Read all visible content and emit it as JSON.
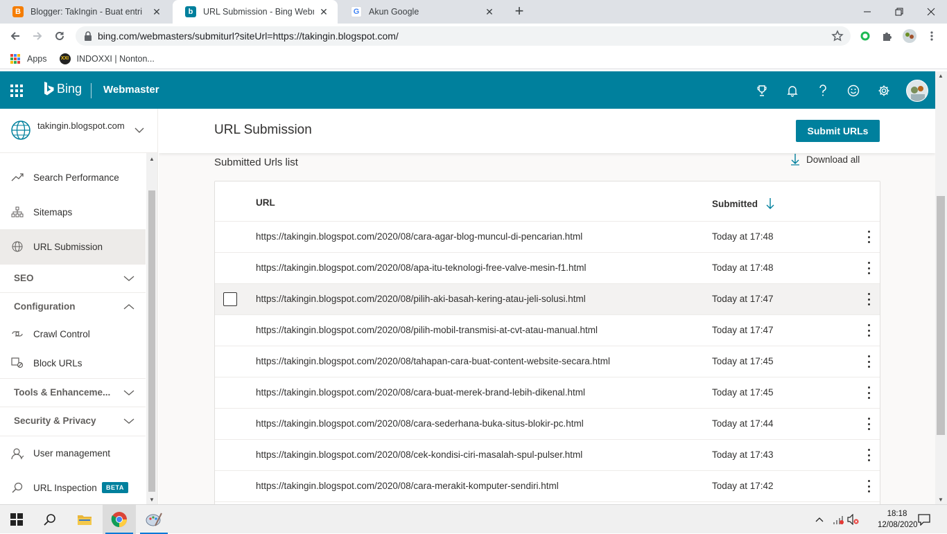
{
  "browser": {
    "tabs": [
      {
        "title": "Blogger: TakIngin - Buat entri",
        "favicon": "blogger-icon"
      },
      {
        "title": "URL Submission - Bing Webmaster",
        "favicon": "bing-icon"
      },
      {
        "title": "Akun Google",
        "favicon": "google-icon"
      }
    ],
    "url": "bing.com/webmasters/submiturl?siteUrl=https://takingin.blogspot.com/",
    "bookmarks": [
      {
        "label": "Apps",
        "icon": "apps-grid-icon"
      },
      {
        "label": "INDOXXI | Nonton...",
        "icon": "indoxxi-icon"
      }
    ]
  },
  "header": {
    "brand": "Bing",
    "product": "Webmaster",
    "icons": [
      "trophy-icon",
      "bell-icon",
      "help-icon",
      "smiley-icon",
      "gear-icon",
      "avatar"
    ]
  },
  "sidebar": {
    "site": "takingin.blogspot.com",
    "items": [
      {
        "label": "Search Performance",
        "icon": "trend-icon"
      },
      {
        "label": "Sitemaps",
        "icon": "sitemap-icon"
      },
      {
        "label": "URL Submission",
        "icon": "globe-icon",
        "active": true
      }
    ],
    "sections": [
      {
        "label": "SEO"
      },
      {
        "label": "Configuration"
      },
      {
        "label": "Tools & Enhanceme..."
      },
      {
        "label": "Security & Privacy"
      }
    ],
    "config_items": [
      {
        "label": "Crawl Control",
        "icon": "crawl-icon"
      },
      {
        "label": "Block URLs",
        "icon": "block-icon"
      }
    ],
    "bottom_items": [
      {
        "label": "User management",
        "icon": "user-icon"
      },
      {
        "label": "URL Inspection",
        "icon": "search-icon",
        "badge": "BETA"
      }
    ]
  },
  "main": {
    "title": "URL Submission",
    "submit_button": "Submit URLs",
    "list_title": "Submitted Urls list",
    "download_all": "Download all",
    "columns": {
      "url": "URL",
      "submitted": "Submitted"
    },
    "rows": [
      {
        "url": "https://takingin.blogspot.com/2020/08/cara-agar-blog-muncul-di-pencarian.html",
        "submitted": "Today at 17:48"
      },
      {
        "url": "https://takingin.blogspot.com/2020/08/apa-itu-teknologi-free-valve-mesin-f1.html",
        "submitted": "Today at 17:48"
      },
      {
        "url": "https://takingin.blogspot.com/2020/08/pilih-aki-basah-kering-atau-jeli-solusi.html",
        "submitted": "Today at 17:47",
        "hover": true
      },
      {
        "url": "https://takingin.blogspot.com/2020/08/pilih-mobil-transmisi-at-cvt-atau-manual.html",
        "submitted": "Today at 17:47"
      },
      {
        "url": "https://takingin.blogspot.com/2020/08/tahapan-cara-buat-content-website-secara.html",
        "submitted": "Today at 17:45"
      },
      {
        "url": "https://takingin.blogspot.com/2020/08/cara-buat-merek-brand-lebih-dikenal.html",
        "submitted": "Today at 17:45"
      },
      {
        "url": "https://takingin.blogspot.com/2020/08/cara-sederhana-buka-situs-blokir-pc.html",
        "submitted": "Today at 17:44"
      },
      {
        "url": "https://takingin.blogspot.com/2020/08/cek-kondisi-ciri-masalah-spul-pulser.html",
        "submitted": "Today at 17:43"
      },
      {
        "url": "https://takingin.blogspot.com/2020/08/cara-merakit-komputer-sendiri.html",
        "submitted": "Today at 17:42"
      }
    ]
  },
  "taskbar": {
    "time": "18:18",
    "date": "12/08/2020"
  },
  "colors": {
    "brand": "#00809d",
    "blogger": "#f57d00",
    "chrome_tab_bg": "#dee1e6"
  }
}
